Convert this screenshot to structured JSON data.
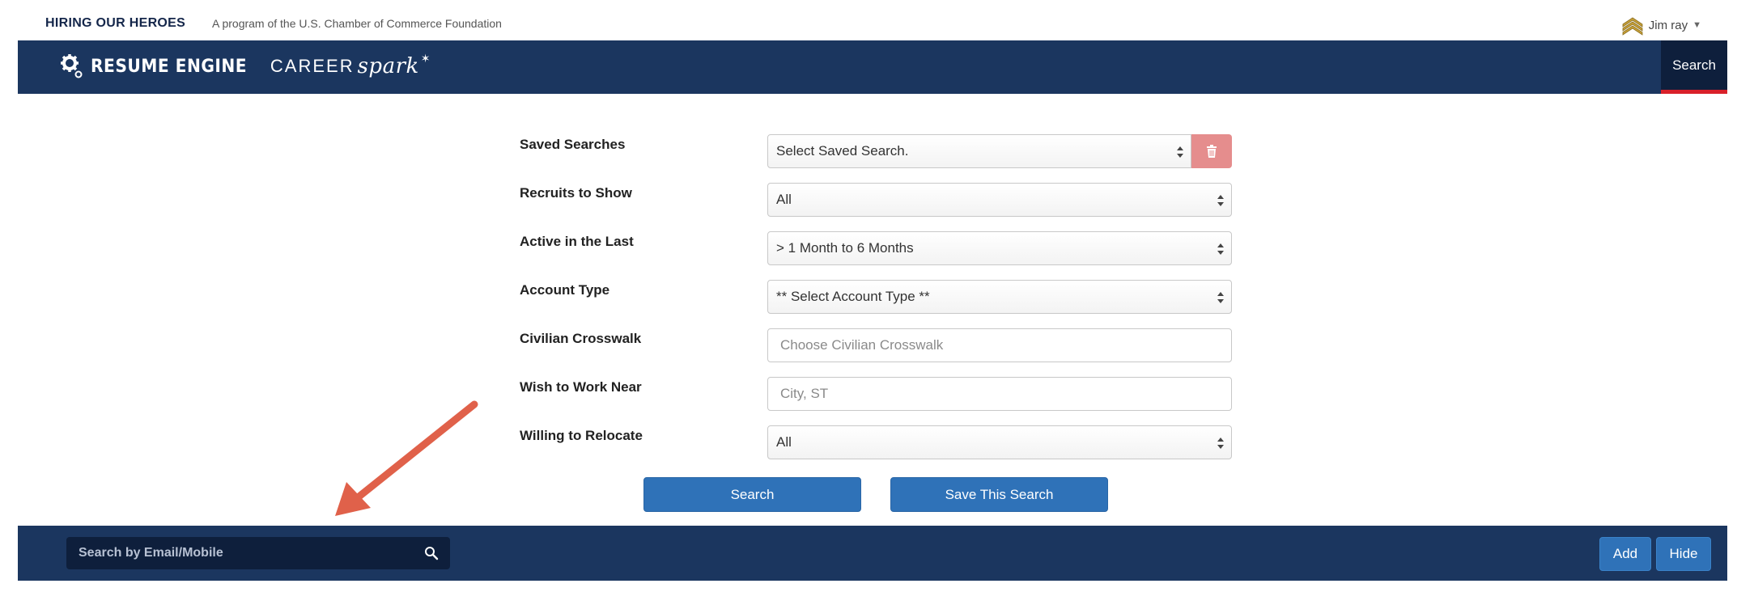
{
  "topbar": {
    "brand": "HIRING OUR HEROES",
    "tagline": "A program of the U.S. Chamber of Commerce Foundation",
    "user_name": "Jim ray",
    "rank_icon": "sergeant-chevron-icon"
  },
  "header": {
    "logo_main": "RESUME ENGINE",
    "logo_career": "CAREER",
    "logo_spark": "spark",
    "nav_search": "Search"
  },
  "form": {
    "saved_searches": {
      "label": "Saved Searches",
      "value": "Select Saved Search."
    },
    "recruits": {
      "label": "Recruits to Show",
      "value": "All"
    },
    "active": {
      "label": "Active in the Last",
      "value": "> 1 Month to 6 Months"
    },
    "account_type": {
      "label": "Account Type",
      "value": "** Select Account Type **"
    },
    "crosswalk": {
      "label": "Civilian Crosswalk",
      "placeholder": "Choose Civilian Crosswalk"
    },
    "work_near": {
      "label": "Wish to Work Near",
      "placeholder": "City, ST"
    },
    "relocate": {
      "label": "Willing to Relocate",
      "value": "All"
    },
    "search_button": "Search",
    "save_button": "Save This Search"
  },
  "bottombar": {
    "email_placeholder": "Search by Email/Mobile",
    "add_button": "Add",
    "hide_button": "Hide"
  },
  "colors": {
    "navy": "#1b365f",
    "dark_navy": "#0e1f3c",
    "primary": "#2f72b8",
    "danger_light": "#e58d8d",
    "accent_red": "#d9202a",
    "annotation": "#e0614a"
  }
}
